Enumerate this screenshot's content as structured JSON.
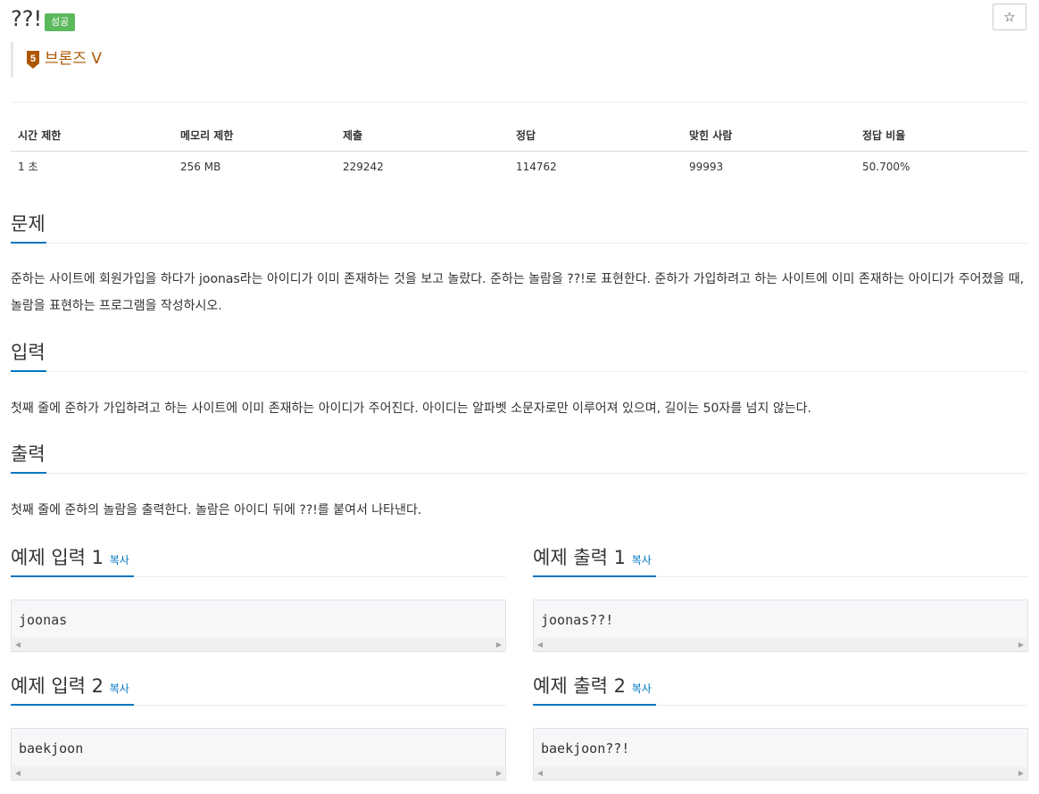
{
  "problem": {
    "title": "??!",
    "result_badge": "성공",
    "star_icon": "star-icon",
    "tier": {
      "number": "5",
      "label": "브론즈 V",
      "color": "#ad5600"
    }
  },
  "stats": {
    "headers": [
      "시간 제한",
      "메모리 제한",
      "제출",
      "정답",
      "맞힌 사람",
      "정답 비율"
    ],
    "values": [
      "1 초",
      "256 MB",
      "229242",
      "114762",
      "99993",
      "50.700%"
    ]
  },
  "sections": {
    "description": {
      "title": "문제",
      "text": "준하는 사이트에 회원가입을 하다가 joonas라는 아이디가 이미 존재하는 것을 보고 놀랐다. 준하는 놀람을 ??!로 표현한다. 준하가 가입하려고 하는 사이트에 이미 존재하는 아이디가 주어졌을 때, 놀람을 표현하는 프로그램을 작성하시오."
    },
    "input": {
      "title": "입력",
      "text": "첫째 줄에 준하가 가입하려고 하는 사이트에 이미 존재하는 아이디가 주어진다. 아이디는 알파벳 소문자로만 이루어져 있으며, 길이는 50자를 넘지 않는다."
    },
    "output": {
      "title": "출력",
      "text": "첫째 줄에 준하의 놀람을 출력한다. 놀람은 아이디 뒤에 ??!를 붙여서 나타낸다."
    }
  },
  "samples": [
    {
      "input_title": "예제 입력 1",
      "output_title": "예제 출력 1",
      "copy_label": "복사",
      "input": "joonas",
      "output": "joonas??!"
    },
    {
      "input_title": "예제 입력 2",
      "output_title": "예제 출력 2",
      "copy_label": "복사",
      "input": "baekjoon",
      "output": "baekjoon??!"
    }
  ],
  "colors": {
    "accent": "#0076c0",
    "success": "#5cb85c",
    "bronze": "#ad5600"
  }
}
